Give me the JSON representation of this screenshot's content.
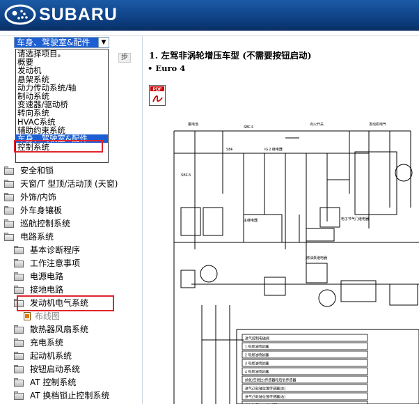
{
  "header": {
    "brand": "SUBARU",
    "logo_icon": "subaru-stars-logo"
  },
  "selector": {
    "value": "车身、驾驶室&配件",
    "options": [
      "请选择项目。",
      "概要",
      "发动机",
      "悬架系统",
      "动力传动系统/轴",
      "制动系统",
      "变速器/驱动桥",
      "转向系统",
      "HVAC系统",
      "辅助约束系统",
      "车身、驾驶室&配件",
      "控制系统"
    ],
    "selected_index": 10
  },
  "step_tab": "步",
  "tree": [
    {
      "label": "安全和锁",
      "level": 0,
      "type": "folder"
    },
    {
      "label": "天窗/T 型顶/活动顶 (天窗)",
      "level": 0,
      "type": "folder"
    },
    {
      "label": "外饰/内饰",
      "level": 0,
      "type": "folder"
    },
    {
      "label": "外车身镶板",
      "level": 0,
      "type": "folder"
    },
    {
      "label": "巡航控制系统",
      "level": 0,
      "type": "folder"
    },
    {
      "label": "电路系统",
      "level": 0,
      "type": "folder-open"
    },
    {
      "label": "基本诊断程序",
      "level": 1,
      "type": "folder"
    },
    {
      "label": "工作注意事项",
      "level": 1,
      "type": "folder"
    },
    {
      "label": "电源电路",
      "level": 1,
      "type": "folder"
    },
    {
      "label": "接地电路",
      "level": 1,
      "type": "folder"
    },
    {
      "label": "发动机电气系统",
      "level": 1,
      "type": "folder-open",
      "highlight": true
    },
    {
      "label": "布线图",
      "level": 2,
      "type": "leaf"
    },
    {
      "label": "散热器风扇系统",
      "level": 1,
      "type": "folder"
    },
    {
      "label": "充电系统",
      "level": 1,
      "type": "folder"
    },
    {
      "label": "起动机系统",
      "level": 1,
      "type": "folder"
    },
    {
      "label": "按钮启动系统",
      "level": 1,
      "type": "folder"
    },
    {
      "label": "AT 控制系统",
      "level": 1,
      "type": "folder"
    },
    {
      "label": "AT 换档锁止控制系统",
      "level": 1,
      "type": "folder"
    }
  ],
  "content": {
    "title": "1. 左驾非涡轮增压车型 (不需要按钮启动)",
    "subtitle": "• Euro 4",
    "pdf_icon": "pdf-icon",
    "pdf_label": "PDF"
  },
  "diagram": {
    "fuse_labels": [
      "SBF-6",
      "SBF-5",
      "SBF",
      "IG 2 继电器"
    ],
    "ecm_rows": [
      "进气控制电磁阀",
      "1 号燃油喷射器",
      "2 号燃油喷射器",
      "3 号燃油喷射器",
      "4 号燃油喷射器",
      "前氧(空燃比)传感器和后氧传感器",
      "进气凸轮轴位置传感器(左)",
      "进气凸轮轴位置传感器(右)",
      "空气流量(A/F)传感器"
    ],
    "relay_labels": [
      "主继电器",
      "燃油泵继电器",
      "电子节气门继电器"
    ]
  },
  "colors": {
    "header": "#0c3d7f",
    "select_highlight": "#1d5fd3",
    "red_box": "#e0242d"
  }
}
